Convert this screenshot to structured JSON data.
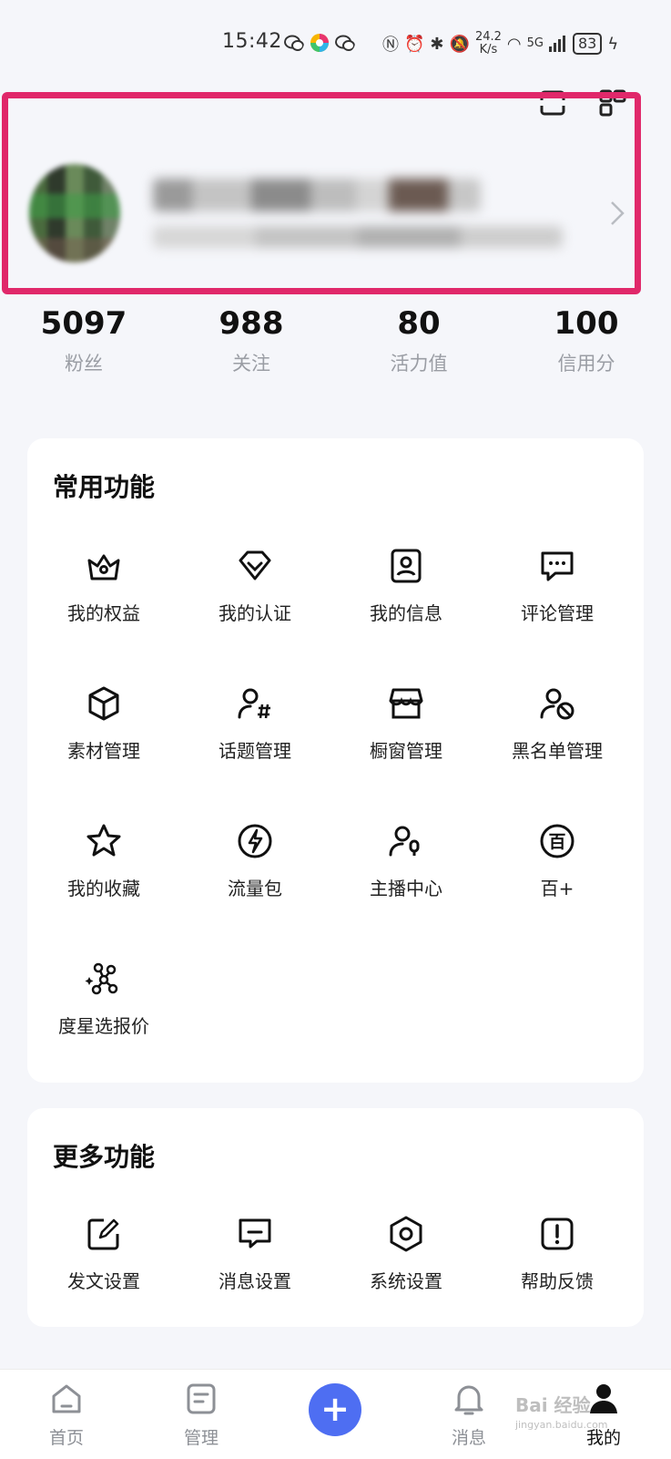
{
  "status_bar": {
    "time": "15:42",
    "net_speed_value": "24.2",
    "net_speed_unit": "K/s",
    "signal": "5G",
    "battery": "83"
  },
  "stats": [
    {
      "value": "5097",
      "label": "粉丝"
    },
    {
      "value": "988",
      "label": "关注"
    },
    {
      "value": "80",
      "label": "活力值"
    },
    {
      "value": "100",
      "label": "信用分"
    }
  ],
  "common": {
    "title": "常用功能",
    "items": [
      {
        "label": "我的权益",
        "icon": "crown-icon"
      },
      {
        "label": "我的认证",
        "icon": "badge-check-icon"
      },
      {
        "label": "我的信息",
        "icon": "id-card-icon"
      },
      {
        "label": "评论管理",
        "icon": "comment-icon"
      },
      {
        "label": "素材管理",
        "icon": "cube-icon"
      },
      {
        "label": "话题管理",
        "icon": "topic-user-icon"
      },
      {
        "label": "橱窗管理",
        "icon": "store-icon"
      },
      {
        "label": "黑名单管理",
        "icon": "block-user-icon"
      },
      {
        "label": "我的收藏",
        "icon": "star-icon"
      },
      {
        "label": "流量包",
        "icon": "lightning-icon"
      },
      {
        "label": "主播中心",
        "icon": "anchor-mic-icon"
      },
      {
        "label": "百+",
        "icon": "bai-icon"
      },
      {
        "label": "度星选报价",
        "icon": "nodes-icon"
      }
    ]
  },
  "more": {
    "title": "更多功能",
    "items": [
      {
        "label": "发文设置",
        "icon": "edit-icon"
      },
      {
        "label": "消息设置",
        "icon": "message-icon"
      },
      {
        "label": "系统设置",
        "icon": "settings-hex-icon"
      },
      {
        "label": "帮助反馈",
        "icon": "help-icon"
      }
    ]
  },
  "tabbar": {
    "home": "首页",
    "manage": "管理",
    "add": "+",
    "messages": "消息",
    "mine": "我的"
  },
  "watermark": {
    "brand": "Bai 经验",
    "url": "jingyan.baidu.com"
  },
  "colors": {
    "accent": "#4e6ef2",
    "highlight": "#e0286a"
  }
}
